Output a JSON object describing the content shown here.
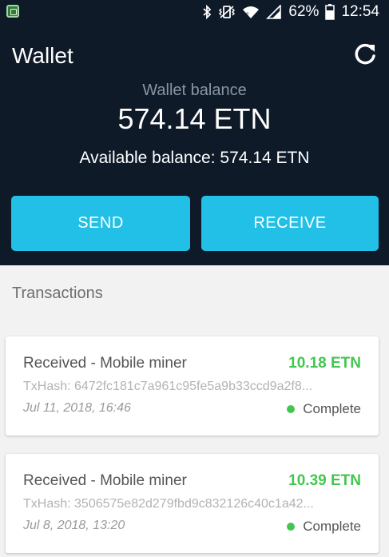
{
  "status_bar": {
    "battery": "62%",
    "time": "12:54",
    "icons": [
      "app-icon",
      "bluetooth-icon",
      "vibrate-icon",
      "wifi-icon",
      "signal-icon",
      "battery-icon"
    ]
  },
  "header": {
    "title": "Wallet",
    "balance_label": "Wallet balance",
    "balance_value": "574.14 ETN",
    "available_balance": "Available balance: 574.14 ETN",
    "send_label": "SEND",
    "receive_label": "RECEIVE"
  },
  "transactions": {
    "title": "Transactions",
    "items": [
      {
        "type": "Received - Mobile miner",
        "amount": "10.18 ETN",
        "hash": "TxHash: 6472fc181c7a961c95fe5a9b33ccd9a2f8...",
        "date": "Jul 11, 2018, 16:46",
        "status": "Complete"
      },
      {
        "type": "Received - Mobile miner",
        "amount": "10.39 ETN",
        "hash": "TxHash: 3506575e82d279fbd9c832126c40c1a42...",
        "date": "Jul 8, 2018, 13:20",
        "status": "Complete"
      }
    ]
  },
  "colors": {
    "header_bg": "#0f1a29",
    "accent": "#22c0e6",
    "positive": "#43c64f",
    "page_bg": "#f2f2f2"
  }
}
